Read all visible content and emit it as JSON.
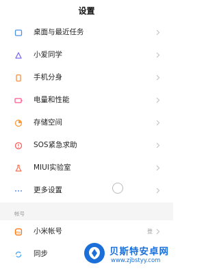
{
  "header": {
    "title": "设置"
  },
  "items": [
    {
      "label": "桌面与最近任务",
      "icon": "home-icon",
      "color": "#4a90e2"
    },
    {
      "label": "小爱同学",
      "icon": "xiaoai-icon",
      "color": "#7a6cf0"
    },
    {
      "label": "手机分身",
      "icon": "phone-clone-icon",
      "color": "#ff8c3a"
    },
    {
      "label": "电量和性能",
      "icon": "battery-icon",
      "color": "#ff5a8c"
    },
    {
      "label": "存储空间",
      "icon": "storage-icon",
      "color": "#ff9a3a"
    },
    {
      "label": "SOS紧急求助",
      "icon": "sos-icon",
      "color": "#ff5a5a"
    },
    {
      "label": "MIUI实验室",
      "icon": "lab-icon",
      "color": "#ff6b4a"
    },
    {
      "label": "更多设置",
      "icon": "more-icon",
      "color": "#5a8cf0"
    }
  ],
  "section": {
    "label": "帐号"
  },
  "account_items": [
    {
      "label": "小米帐号",
      "value": "登",
      "icon": "mi-icon",
      "color": "#ff6a00"
    },
    {
      "label": "同步",
      "icon": "sync-icon",
      "color": "#3aa0ff"
    }
  ],
  "watermark": {
    "title": "贝斯特安卓网",
    "url": "www.zjbstyy.com"
  }
}
